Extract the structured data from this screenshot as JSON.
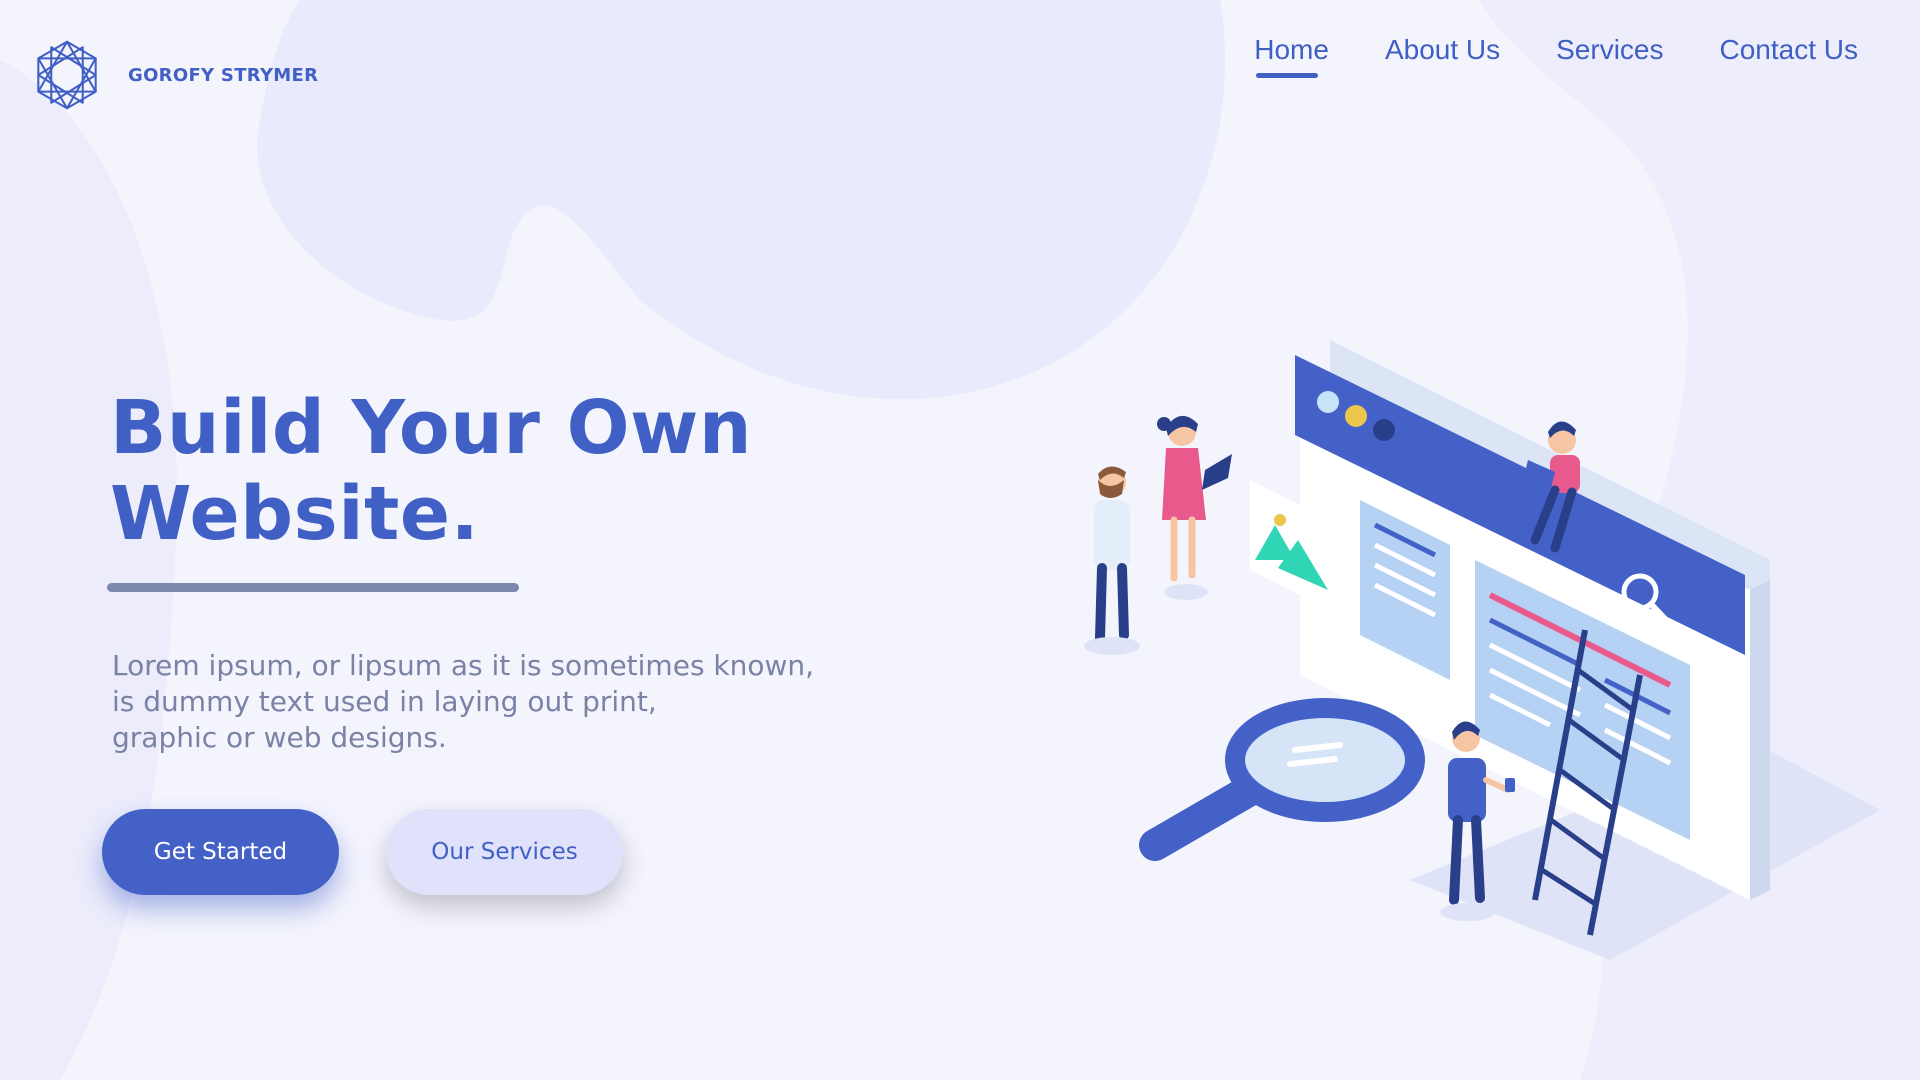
{
  "brand": {
    "name": "GOROFY STRYMER",
    "logo_icon": "star-polygon-logo-icon"
  },
  "nav": {
    "items": [
      {
        "label": "Home",
        "active": true
      },
      {
        "label": "About Us",
        "active": false
      },
      {
        "label": "Services",
        "active": false
      },
      {
        "label": "Contact Us",
        "active": false
      }
    ]
  },
  "hero": {
    "title_line1": "Build Your Own",
    "title_line2": "Website.",
    "description_lines": [
      "Lorem ipsum, or lipsum as it is sometimes known,",
      "is dummy text used in laying out print,",
      "graphic or web designs."
    ],
    "primary_button": "Get Started",
    "secondary_button": "Our Services"
  },
  "colors": {
    "accent": "#4160c6",
    "background": "#f4f4fd",
    "muted_text": "#7a83a6",
    "pink": "#e85a8c",
    "teal": "#2fd5b5",
    "yellow": "#ecc64a"
  },
  "illustration": {
    "icon": "website-builder-team-illustration"
  }
}
